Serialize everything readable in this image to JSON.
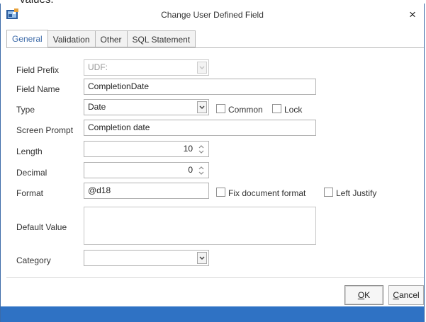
{
  "top_strip_text": "values.",
  "dialog": {
    "title": "Change User Defined Field",
    "close_glyph": "×",
    "app_icon": "database-icon"
  },
  "tabs": [
    {
      "label": "General",
      "active": true
    },
    {
      "label": "Validation",
      "active": false
    },
    {
      "label": "Other",
      "active": false
    },
    {
      "label": "SQL Statement",
      "active": false
    }
  ],
  "form": {
    "field_prefix": {
      "label": "Field Prefix",
      "value": "UDF:",
      "disabled": true
    },
    "field_name": {
      "label": "Field Name",
      "value": "CompletionDate"
    },
    "type": {
      "label": "Type",
      "value": "Date",
      "common_label": "Common",
      "common_checked": false,
      "lock_label": "Lock",
      "lock_checked": false
    },
    "screen_prompt": {
      "label": "Screen Prompt",
      "value": "Completion date"
    },
    "length": {
      "label": "Length",
      "value": "10"
    },
    "decimal": {
      "label": "Decimal",
      "value": "0"
    },
    "format": {
      "label": "Format",
      "value": "@d18",
      "fix_label": "Fix document format",
      "fix_checked": false,
      "left_label": "Left Justify",
      "left_checked": false
    },
    "default_value": {
      "label": "Default Value",
      "value": ""
    },
    "category": {
      "label": "Category",
      "value": ""
    }
  },
  "buttons": {
    "ok_accel": "O",
    "ok_rest": "K",
    "cancel_accel": "C",
    "cancel_rest": "ancel"
  },
  "colors": {
    "accent": "#3c6aa8",
    "status_bar": "#2f72c4"
  }
}
